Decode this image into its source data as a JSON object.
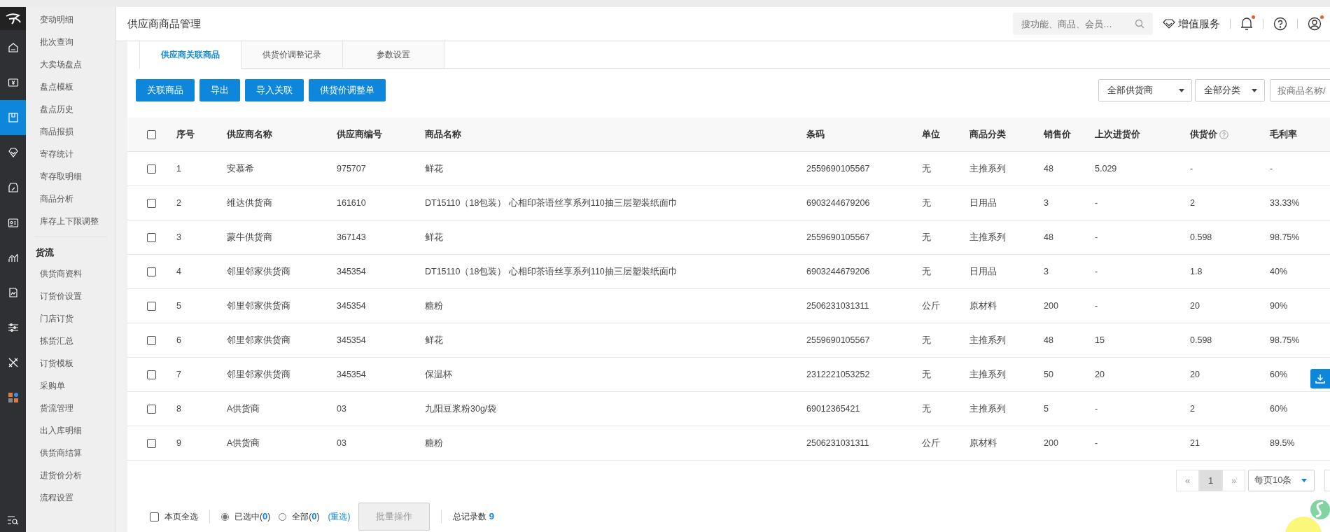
{
  "rail": [
    {
      "selected": false
    },
    {
      "selected": false
    },
    {
      "selected": true
    },
    {
      "selected": false
    },
    {
      "selected": false
    },
    {
      "selected": false
    },
    {
      "selected": false
    },
    {
      "selected": false
    },
    {
      "selected": false
    },
    {
      "selected": false
    },
    {
      "selected": false
    }
  ],
  "submenu": [
    {
      "kind": "item",
      "label": "变动明细"
    },
    {
      "kind": "item",
      "label": "批次查询"
    },
    {
      "kind": "item",
      "label": "大卖场盘点"
    },
    {
      "kind": "item",
      "label": "盘点模板"
    },
    {
      "kind": "item",
      "label": "盘点历史"
    },
    {
      "kind": "item",
      "label": "商品报损"
    },
    {
      "kind": "item",
      "label": "寄存统计"
    },
    {
      "kind": "item",
      "label": "寄存取明细"
    },
    {
      "kind": "item",
      "label": "商品分析"
    },
    {
      "kind": "item",
      "label": "库存上下限调整"
    },
    {
      "kind": "group",
      "label": "货流"
    },
    {
      "kind": "item",
      "label": "供货商资料"
    },
    {
      "kind": "item",
      "label": "订货价设置"
    },
    {
      "kind": "item",
      "label": "门店订货"
    },
    {
      "kind": "item",
      "label": "拣货汇总"
    },
    {
      "kind": "item",
      "label": "订货模板"
    },
    {
      "kind": "item",
      "label": "采购单"
    },
    {
      "kind": "item",
      "label": "货流管理"
    },
    {
      "kind": "item",
      "label": "出入库明细"
    },
    {
      "kind": "item",
      "label": "供货商结算"
    },
    {
      "kind": "item",
      "label": "进货价分析"
    },
    {
      "kind": "item",
      "label": "流程设置"
    }
  ],
  "header": {
    "title": "供应商商品管理",
    "search": {
      "placeholder": "搜功能、商品、会员…"
    },
    "service": "增值服务",
    "bell_unread": true,
    "user_unread": true
  },
  "tabs": [
    {
      "label": "供应商关联商品",
      "selected": true
    },
    {
      "label": "供货价调整记录",
      "selected": false
    },
    {
      "label": "参数设置",
      "selected": false
    }
  ],
  "buttons": [
    "关联商品",
    "导出",
    "导入关联",
    "供货价调整单"
  ],
  "filters": {
    "supplier": "全部供货商",
    "category": "全部分类",
    "search_placeholder": "按商品名称/"
  },
  "table": {
    "select_all_checked": false,
    "columns": [
      {
        "label": "序号",
        "help": false
      },
      {
        "label": "供应商名称",
        "help": false
      },
      {
        "label": "供应商编号",
        "help": false
      },
      {
        "label": "商品名称",
        "help": false
      },
      {
        "label": "条码",
        "help": false
      },
      {
        "label": "单位",
        "help": false
      },
      {
        "label": "商品分类",
        "help": false
      },
      {
        "label": "销售价",
        "help": false
      },
      {
        "label": "上次进货价",
        "help": false
      },
      {
        "label": "供货价",
        "help": true
      },
      {
        "label": "毛利率",
        "help": false
      }
    ],
    "rows": [
      {
        "checked": false,
        "cells": [
          "1",
          "安慕希",
          "975707",
          "鲜花",
          "2559690105567",
          "无",
          "主推系列",
          "48",
          "5.029",
          "-",
          "-"
        ]
      },
      {
        "checked": false,
        "cells": [
          "2",
          "维达供货商",
          "161610",
          "DT15110（18包装） 心相印茶语丝享系列110抽三层塑装纸面巾",
          "6903244679206",
          "无",
          "日用品",
          "3",
          "-",
          "2",
          "33.33%"
        ]
      },
      {
        "checked": false,
        "cells": [
          "3",
          "蒙牛供货商",
          "367143",
          "鲜花",
          "2559690105567",
          "无",
          "主推系列",
          "48",
          "-",
          "0.598",
          "98.75%"
        ]
      },
      {
        "checked": false,
        "cells": [
          "4",
          "邻里邻家供货商",
          "345354",
          "DT15110（18包装） 心相印茶语丝享系列110抽三层塑装纸面巾",
          "6903244679206",
          "无",
          "日用品",
          "3",
          "-",
          "1.8",
          "40%"
        ]
      },
      {
        "checked": false,
        "cells": [
          "5",
          "邻里邻家供货商",
          "345354",
          "糖粉",
          "2506231031311",
          "公斤",
          "原材料",
          "200",
          "-",
          "20",
          "90%"
        ]
      },
      {
        "checked": false,
        "cells": [
          "6",
          "邻里邻家供货商",
          "345354",
          "鲜花",
          "2559690105567",
          "无",
          "主推系列",
          "48",
          "15",
          "0.598",
          "98.75%"
        ]
      },
      {
        "checked": false,
        "cells": [
          "7",
          "邻里邻家供货商",
          "345354",
          "保温杯",
          "2312221053252",
          "无",
          "主推系列",
          "50",
          "20",
          "20",
          "60%"
        ]
      },
      {
        "checked": false,
        "cells": [
          "8",
          "A供货商",
          "03",
          "九阳豆浆粉30g/袋",
          "69012365421",
          "无",
          "主推系列",
          "5",
          "-",
          "2",
          "60%"
        ]
      },
      {
        "checked": false,
        "cells": [
          "9",
          "A供货商",
          "03",
          "糖粉",
          "2506231031311",
          "公斤",
          "原材料",
          "200",
          "-",
          "21",
          "89.5%"
        ]
      }
    ]
  },
  "pagination": {
    "prev": "«",
    "next": "»",
    "pages": [
      {
        "label": "1",
        "selected": true
      }
    ],
    "per_page": "每页10条"
  },
  "footer": {
    "select_page": {
      "label": "本页全选",
      "checked": false
    },
    "radios": [
      {
        "label": "已选中(**0**)",
        "selected": true
      },
      {
        "label": "全部(**0**)",
        "selected": false
      }
    ],
    "reset": "(重选)",
    "batch": {
      "label": "批量操作",
      "disabled": true
    },
    "total": "总记录数 **9**"
  }
}
